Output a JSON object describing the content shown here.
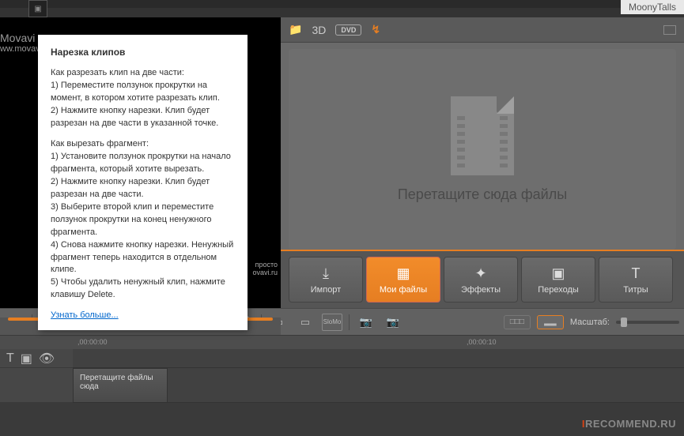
{
  "watermarks": {
    "top": "MoonyTalls",
    "bottom_pre": "I",
    "bottom_rest": "RECOMMEND.RU"
  },
  "brand": {
    "name": "Movavi",
    "url": "ww.movavl."
  },
  "preview_hint": {
    "l1": "просто",
    "l2": "ovavi.ru"
  },
  "tooltip": {
    "title": "Нарезка клипов",
    "p1": "Как разрезать клип на две части:\n1) Переместите ползунок прокрутки на момент, в котором хотите разрезать клип.\n2) Нажмите кнопку нарезки. Клип будет разрезан на две части в указанной точке.",
    "p2": "Как вырезать фрагмент:\n1) Установите ползунок прокрутки на начало фрагмента, который хотите вырезать.\n2) Нажмите кнопку нарезки. Клип будет разрезан на две части.\n3) Выберите второй клип и переместите ползунок прокрутки на конец ненужного фрагмента.\n4) Снова нажмите кнопку нарезки. Ненужный фрагмент теперь находится в отдельном клипе.\n5) Чтобы удалить ненужный клип, нажмите клавишу Delete.",
    "link": "Узнать больше..."
  },
  "media_top": {
    "three_d": "3D",
    "dvd": "DVD"
  },
  "drop_text": "Перетащите сюда файлы",
  "tabs": {
    "import": "Импорт",
    "files": "Мои файлы",
    "effects": "Эффекты",
    "transitions": "Переходы",
    "titles": "Титры"
  },
  "toolbar": {
    "slomo": "SloMo",
    "zoom_label": "Масштаб:"
  },
  "ruler": {
    "t0": ",00:00:00",
    "t10": ",00:00:10"
  },
  "clip": {
    "text": "Перетащите файлы сюда"
  }
}
